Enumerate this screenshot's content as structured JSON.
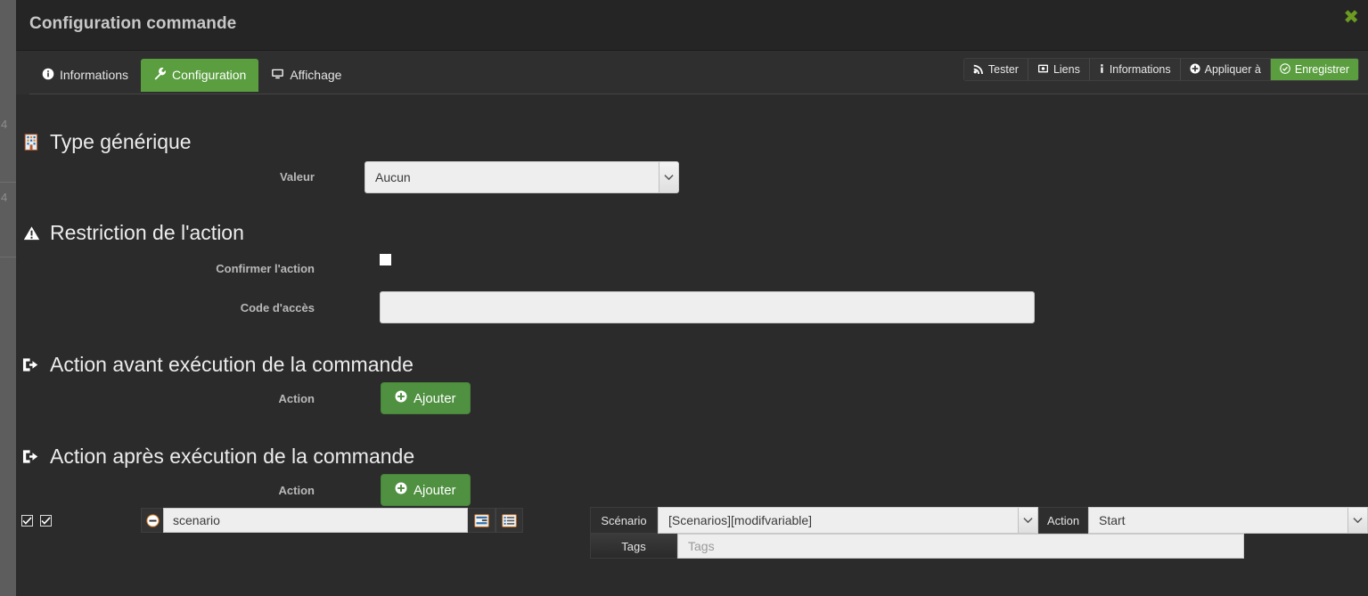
{
  "background": {
    "page_marks": [
      "4",
      "4"
    ]
  },
  "modal": {
    "title": "Configuration commande",
    "close_label": "✖",
    "accent_green": "#5a9e3f",
    "body_bg": "#2b2b2b"
  },
  "tabs": [
    {
      "label": "Informations",
      "icon": "info-circle-icon",
      "active": false
    },
    {
      "label": "Configuration",
      "icon": "wrench-icon",
      "active": true
    },
    {
      "label": "Affichage",
      "icon": "desktop-icon",
      "active": false
    }
  ],
  "toolbar": [
    {
      "label": "Tester",
      "icon": "rss-icon",
      "primary": false
    },
    {
      "label": "Liens",
      "icon": "link-image-icon",
      "primary": false
    },
    {
      "label": "Informations",
      "icon": "info-icon",
      "primary": false
    },
    {
      "label": "Appliquer à",
      "icon": "plus-circle-icon",
      "primary": false
    },
    {
      "label": "Enregistrer",
      "icon": "check-circle-icon",
      "primary": true
    }
  ],
  "sections": {
    "generic_type": {
      "title": "Type générique",
      "icon": "building-icon",
      "value_label": "Valeur",
      "value_selected": "Aucun"
    },
    "restriction": {
      "title": "Restriction de l'action",
      "icon": "warning-triangle-icon",
      "confirm_label": "Confirmer l'action",
      "confirm_checked": false,
      "code_label": "Code d'accès",
      "code_value": ""
    },
    "action_before": {
      "title": "Action avant exécution de la commande",
      "icon": "sign-out-icon",
      "action_label": "Action",
      "add_button": "Ajouter"
    },
    "action_after": {
      "title": "Action après exécution de la commande",
      "icon": "sign-out-icon",
      "action_label": "Action",
      "add_button": "Ajouter"
    }
  },
  "action_row": {
    "checkbox_1_checked": true,
    "checkbox_2_checked": true,
    "remove_icon": "minus-circle-icon",
    "command_value": "scenario",
    "tool_icon_1": "sliders-list-icon",
    "tool_icon_2": "list-alt-icon",
    "scenario_label": "Scénario",
    "scenario_value": "[Scenarios][modifvariable]",
    "action_label": "Action",
    "action_value": "Start",
    "tags_label": "Tags",
    "tags_placeholder": "Tags",
    "tags_value": ""
  }
}
